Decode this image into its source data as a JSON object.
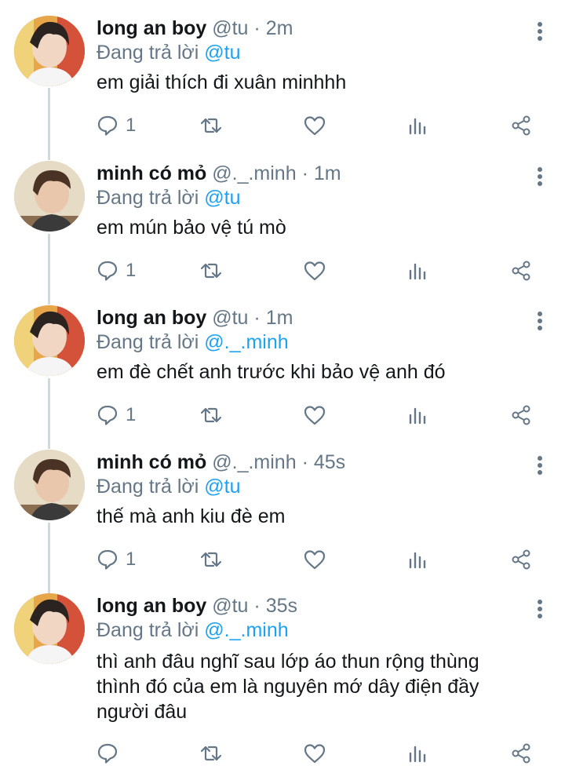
{
  "reply_prefix": "Đang trả lời",
  "tweets": [
    {
      "name": "long an boy",
      "handle": "@tu",
      "time": "2m",
      "reply_to": "@tu",
      "text": "em giải thích đi xuân minhhh",
      "reply_count": "1"
    },
    {
      "name": "minh có mỏ",
      "handle": "@._.minh",
      "time": "1m",
      "reply_to": "@tu",
      "text": "em mún bảo vệ tú mò",
      "reply_count": "1"
    },
    {
      "name": "long an boy",
      "handle": "@tu",
      "time": "1m",
      "reply_to": "@._.minh",
      "text": "em đè chết anh trước khi bảo vệ anh đó",
      "reply_count": "1"
    },
    {
      "name": "minh có mỏ",
      "handle": "@._.minh",
      "time": "45s",
      "reply_to": "@tu",
      "text": "thế mà anh kiu đè em",
      "reply_count": "1"
    },
    {
      "name": "long an boy",
      "handle": "@tu",
      "time": "35s",
      "reply_to": "@._.minh",
      "text_lines": [
        "thì anh đâu nghĩ sau lớp áo thun rộng thùng",
        "thình đó của em là nguyên mớ dây điện đầy",
        "người đâu"
      ],
      "reply_count": ""
    }
  ],
  "colors": {
    "accent": "#1da1f2",
    "secondary": "#657786",
    "primary_text": "#14171a",
    "thread_line": "#cfd9de"
  },
  "icons": [
    "reply-icon",
    "retweet-icon",
    "like-icon",
    "analytics-icon",
    "share-icon",
    "more-options-icon"
  ]
}
